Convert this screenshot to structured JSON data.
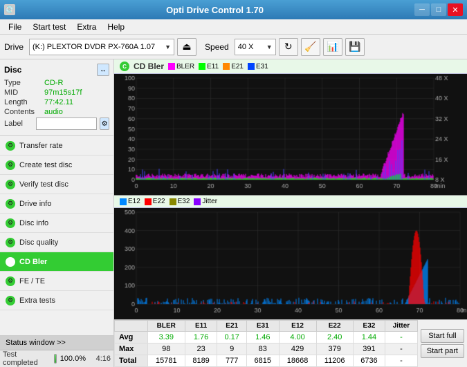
{
  "app": {
    "title": "Opti Drive Control 1.70",
    "icon": "💿"
  },
  "titlebar": {
    "minimize": "─",
    "maximize": "□",
    "close": "✕"
  },
  "menu": {
    "items": [
      "File",
      "Start test",
      "Extra",
      "Help"
    ]
  },
  "toolbar": {
    "drive_label": "Drive",
    "drive_value": "(K:)  PLEXTOR DVDR  PX-760A 1.07",
    "speed_label": "Speed",
    "speed_value": "40 X"
  },
  "disc": {
    "title": "Disc",
    "type_label": "Type",
    "type_value": "CD-R",
    "mid_label": "MID",
    "mid_value": "97m15s17f",
    "length_label": "Length",
    "length_value": "77:42.11",
    "contents_label": "Contents",
    "contents_value": "audio",
    "label_label": "Label",
    "label_value": ""
  },
  "nav": {
    "items": [
      {
        "id": "transfer-rate",
        "label": "Transfer rate",
        "active": false
      },
      {
        "id": "create-test-disc",
        "label": "Create test disc",
        "active": false
      },
      {
        "id": "verify-test-disc",
        "label": "Verify test disc",
        "active": false
      },
      {
        "id": "drive-info",
        "label": "Drive info",
        "active": false
      },
      {
        "id": "disc-info",
        "label": "Disc info",
        "active": false
      },
      {
        "id": "disc-quality",
        "label": "Disc quality",
        "active": false
      },
      {
        "id": "cd-bler",
        "label": "CD Bler",
        "active": true
      },
      {
        "id": "fe-te",
        "label": "FE / TE",
        "active": false
      },
      {
        "id": "extra-tests",
        "label": "Extra tests",
        "active": false
      }
    ]
  },
  "chart1": {
    "title": "CD Bler",
    "legend": [
      {
        "label": "BLER",
        "color": "#ff00ff"
      },
      {
        "label": "E11",
        "color": "#00ff00"
      },
      {
        "label": "E21",
        "color": "#ff8800"
      },
      {
        "label": "E31",
        "color": "#0000ff"
      }
    ],
    "y_max": 100,
    "y_labels": [
      "100",
      "90",
      "80",
      "70",
      "60",
      "50",
      "40",
      "30",
      "20",
      "10",
      "0"
    ],
    "x_labels": [
      "0",
      "10",
      "20",
      "30",
      "40",
      "50",
      "60",
      "70",
      "80"
    ],
    "right_labels": [
      "48 X",
      "40 X",
      "32 X",
      "24 X",
      "16 X",
      "8 X"
    ]
  },
  "chart2": {
    "legend": [
      {
        "label": "E12",
        "color": "#0088ff"
      },
      {
        "label": "E22",
        "color": "#ff0000"
      },
      {
        "label": "E32",
        "color": "#888800"
      },
      {
        "label": "Jitter",
        "color": "#8800ff"
      }
    ],
    "y_max": 500,
    "y_labels": [
      "500",
      "400",
      "300",
      "200",
      "100",
      "0"
    ],
    "x_labels": [
      "0",
      "10",
      "20",
      "30",
      "40",
      "50",
      "60",
      "70",
      "80"
    ]
  },
  "table": {
    "columns": [
      "",
      "BLER",
      "E11",
      "E21",
      "E31",
      "E12",
      "E22",
      "E32",
      "Jitter"
    ],
    "rows": [
      {
        "label": "Avg",
        "values": [
          "3.39",
          "1.76",
          "0.17",
          "1.46",
          "4.00",
          "2.40",
          "1.44",
          "-"
        ],
        "green": true
      },
      {
        "label": "Max",
        "values": [
          "98",
          "23",
          "9",
          "83",
          "429",
          "379",
          "391",
          "-"
        ],
        "green": false
      },
      {
        "label": "Total",
        "values": [
          "15781",
          "8189",
          "777",
          "6815",
          "18668",
          "11206",
          "6736",
          "-"
        ],
        "green": false
      }
    ],
    "start_full_label": "Start full",
    "start_part_label": "Start part"
  },
  "status": {
    "window_btn_label": "Status window >>",
    "complete_text": "Test completed",
    "progress_percent": "100.0%",
    "time": "4:16"
  },
  "colors": {
    "accent_green": "#33cc33",
    "title_bg": "#3a8fc5"
  }
}
